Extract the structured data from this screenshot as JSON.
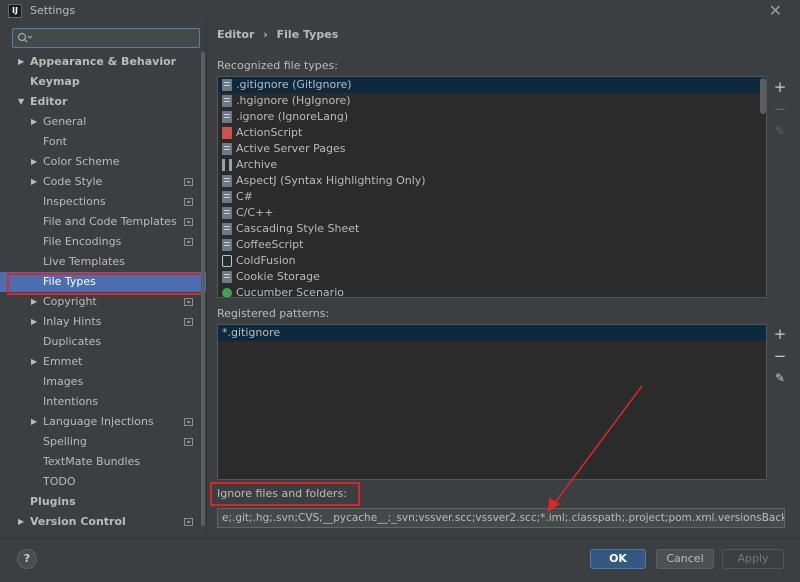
{
  "window": {
    "title": "Settings",
    "close_glyph": "✕"
  },
  "app_icon": {
    "text": "IJ"
  },
  "search": {
    "placeholder": ""
  },
  "tree": {
    "appearance": "Appearance & Behavior",
    "keymap": "Keymap",
    "editor": "Editor",
    "general": "General",
    "font": "Font",
    "color_scheme": "Color Scheme",
    "code_style": "Code Style",
    "inspections": "Inspections",
    "file_code_templates": "File and Code Templates",
    "file_encodings": "File Encodings",
    "live_templates": "Live Templates",
    "file_types": "File Types",
    "copyright": "Copyright",
    "inlay_hints": "Inlay Hints",
    "duplicates": "Duplicates",
    "emmet": "Emmet",
    "images": "Images",
    "intentions": "Intentions",
    "language_injections": "Language Injections",
    "spelling": "Spelling",
    "textmate": "TextMate Bundles",
    "todo": "TODO",
    "plugins": "Plugins",
    "version_control": "Version Control"
  },
  "breadcrumb": {
    "parent": "Editor",
    "sep": "›",
    "current": "File Types"
  },
  "recognized": {
    "label": "Recognized file types:",
    "items": [
      ".gitignore (GitIgnore)",
      ".hgignore (HgIgnore)",
      ".ignore (IgnoreLang)",
      "ActionScript",
      "Active Server Pages",
      "Archive",
      "AspectJ (Syntax Highlighting Only)",
      "C#",
      "C/C++",
      "Cascading Style Sheet",
      "CoffeeScript",
      "ColdFusion",
      "Cookie Storage",
      "Cucumber Scenario"
    ]
  },
  "patterns": {
    "label": "Registered patterns:",
    "items": [
      "*.gitignore"
    ]
  },
  "ignore": {
    "label": "Ignore files and folders:",
    "value": "e;.git;.hg;.svn;CVS;__pycache__;_svn;vssver.scc;vssver2.scc;*.iml;.classpath;.project;pom.xml.versionsBackup;.idea;.settings;"
  },
  "tools": {
    "add": "+",
    "remove": "−",
    "edit": "✎"
  },
  "buttons": {
    "help": "?",
    "ok": "OK",
    "cancel": "Cancel",
    "apply": "Apply"
  },
  "colors": {
    "accent": "#4b6eaf",
    "highlight_red": "#d9262d",
    "ok_button": "#365880"
  }
}
